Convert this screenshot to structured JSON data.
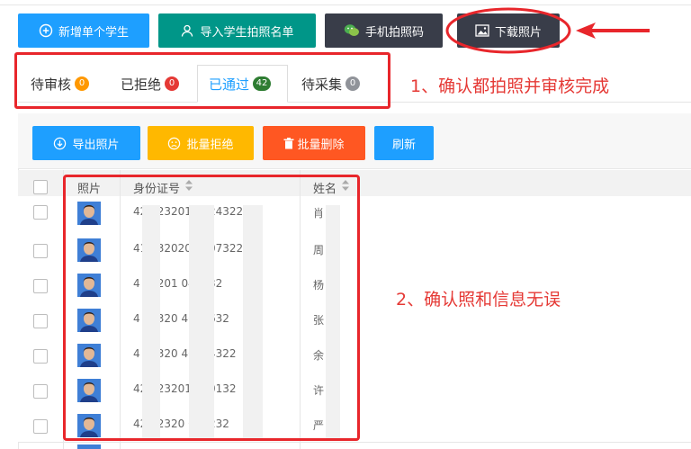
{
  "colors": {
    "accent": "#1e9fff",
    "brand_green": "#009688",
    "dark": "#393d49",
    "warning": "#ffb800",
    "danger": "#ff5722",
    "annotation": "#e53935",
    "badge_orange": "#ff9800",
    "badge_red": "#e53935",
    "badge_green": "#2e7d32",
    "badge_gray": "#909399"
  },
  "top_buttons": [
    {
      "label": "新增单个学生",
      "icon": "plus-circle-icon",
      "color": "#1e9fff"
    },
    {
      "label": "导入学生拍照名单",
      "icon": "user-icon",
      "color": "#009688"
    },
    {
      "label": "手机拍照码",
      "icon": "wechat-icon",
      "color": "#393d49"
    },
    {
      "label": "下载照片",
      "icon": "image-icon",
      "color": "#393d49"
    }
  ],
  "tabs": [
    {
      "label": "待审核",
      "count": "0",
      "badge_color": "#ff9800",
      "active": false
    },
    {
      "label": "已拒绝",
      "count": "0",
      "badge_color": "#e53935",
      "active": false
    },
    {
      "label": "已通过",
      "count": "42",
      "badge_color": "#2e7d32",
      "active": true
    },
    {
      "label": "待采集",
      "count": "0",
      "badge_color": "#909399",
      "active": false
    }
  ],
  "toolbar_buttons": [
    {
      "label": "导出照片",
      "icon": "download-circle-icon",
      "color": "#1e9fff"
    },
    {
      "label": "批量拒绝",
      "icon": "sad-face-icon",
      "color": "#ffb800"
    },
    {
      "label": "批量删除",
      "icon": "trash-icon",
      "color": "#ff5722"
    },
    {
      "label": "刷新",
      "icon": "",
      "color": "#1e9fff"
    }
  ],
  "table": {
    "columns": [
      "照片",
      "身份证号",
      "姓名"
    ],
    "rows": [
      {
        "id": "42  123201  06243229",
        "name": "肖  洁"
      },
      {
        "id": "41  232020  0507322",
        "name": "周  馨"
      },
      {
        "id": "4   23201  040832",
        "name": "杨  光"
      },
      {
        "id": "4   12320  4041632",
        "name": "张  贤"
      },
      {
        "id": "4   12320  40204322",
        "name": "余  鑫"
      },
      {
        "id": "42  123201  010132",
        "name": "许  冉"
      },
      {
        "id": "42  12320  082232",
        "name": "严  瑞"
      }
    ]
  },
  "annotations": {
    "note1": "1、确认都拍照并审核完成",
    "note2": "2、确认照和信息无误"
  }
}
